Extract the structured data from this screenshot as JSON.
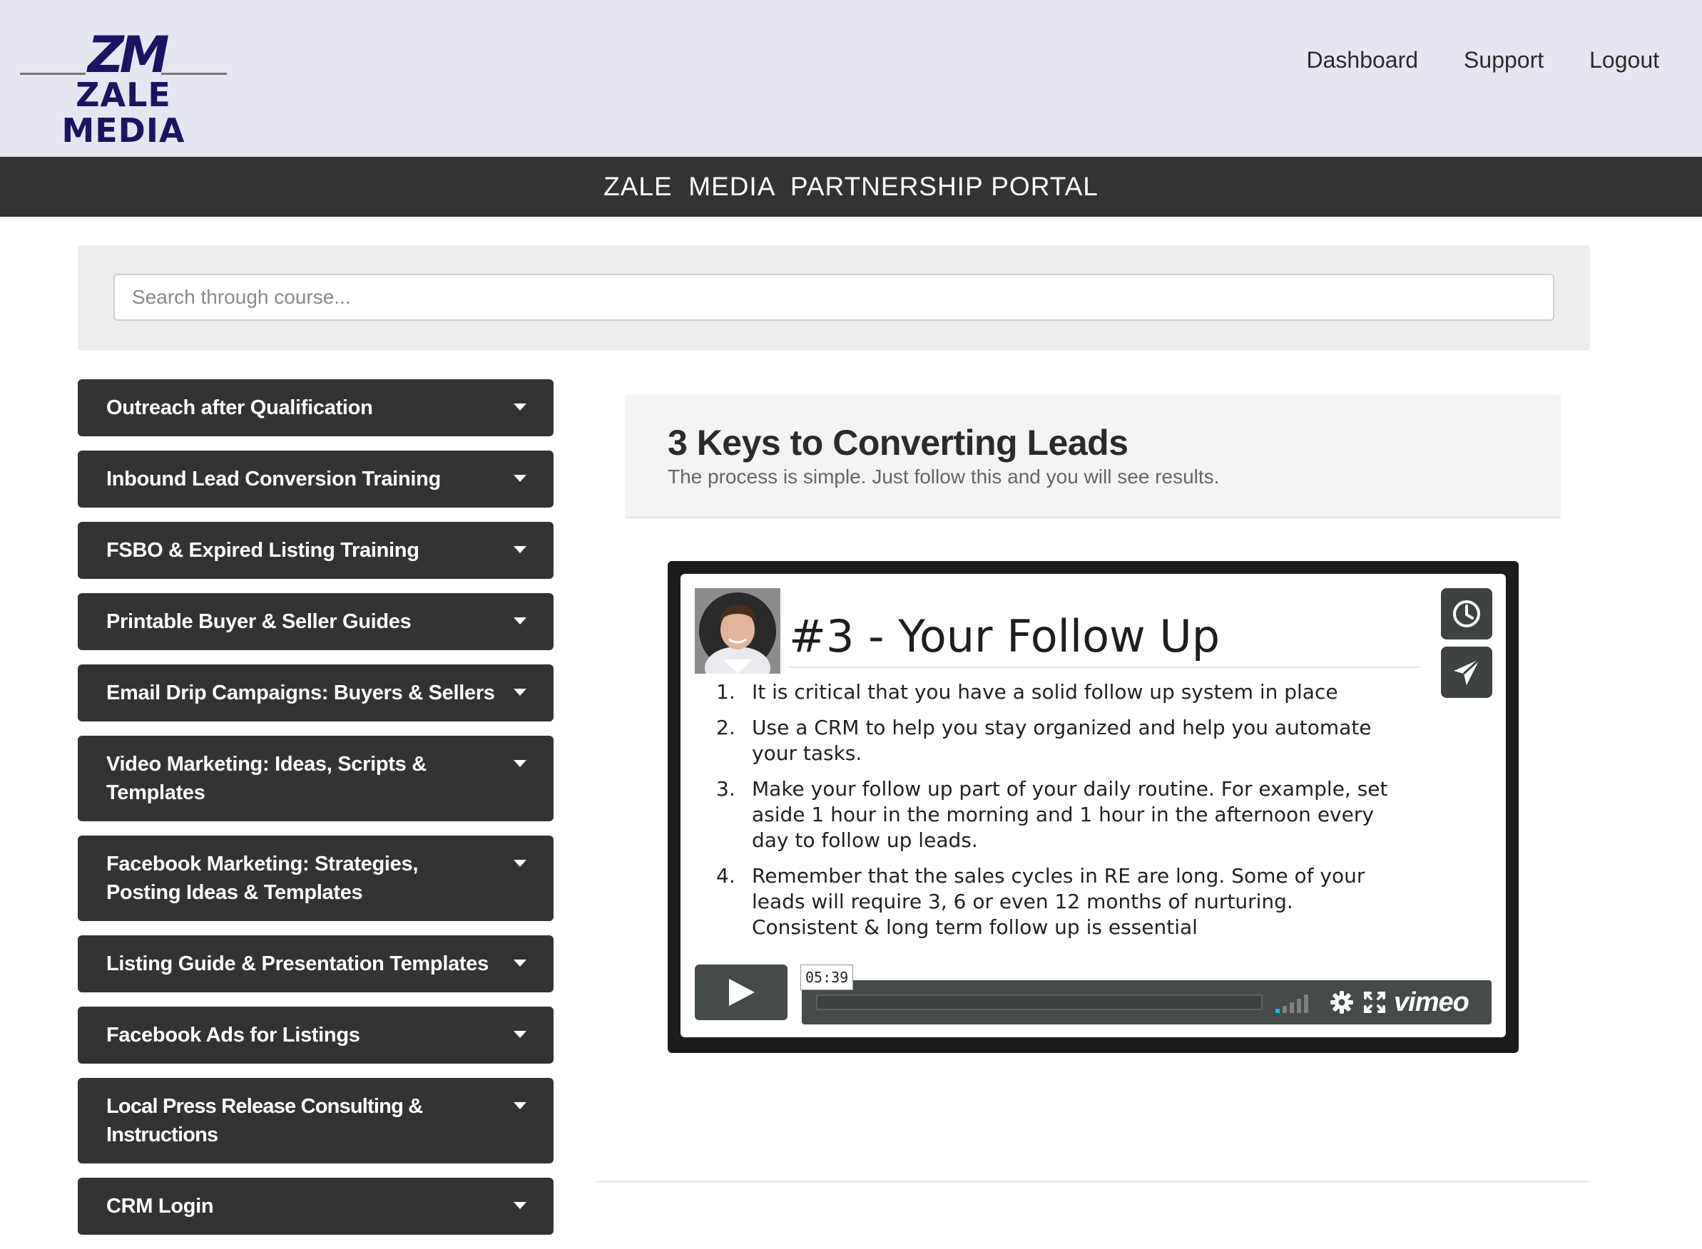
{
  "brand": {
    "monogram": "ZM",
    "name": "ZALE MEDIA",
    "color": "#1a1464"
  },
  "nav": {
    "items": [
      {
        "label": "Dashboard"
      },
      {
        "label": "Support"
      },
      {
        "label": "Logout"
      }
    ]
  },
  "banner": {
    "title": "ZALE  MEDIA  PARTNERSHIP PORTAL"
  },
  "search": {
    "placeholder": "Search through course..."
  },
  "sidebar": {
    "items": [
      {
        "label": "Outreach after Qualification"
      },
      {
        "label": "Inbound Lead Conversion Training"
      },
      {
        "label": "FSBO & Expired Listing Training"
      },
      {
        "label": "Printable Buyer & Seller Guides"
      },
      {
        "label": "Email Drip Campaigns: Buyers & Sellers"
      },
      {
        "label": "Video Marketing: Ideas, Scripts & Templates"
      },
      {
        "label": "Facebook Marketing: Strategies, Posting Ideas & Templates"
      },
      {
        "label": "Listing Guide & Presentation Templates"
      },
      {
        "label": "Facebook Ads for Listings"
      },
      {
        "label": "Local Press Release Consulting & Instructions"
      },
      {
        "label": "CRM Login"
      }
    ]
  },
  "lesson": {
    "title": "3 Keys to Converting Leads",
    "subtitle": "The process is simple. Just follow this and you will see results."
  },
  "video": {
    "title": "#3 - Your Follow Up",
    "steps": [
      {
        "num": "1.",
        "text": "It is critical that you have a solid follow up system in place"
      },
      {
        "num": "2.",
        "text": "Use a CRM to help you stay organized and help you automate your tasks."
      },
      {
        "num": "3.",
        "text": "Make your follow up part of your daily routine. For example, set aside 1 hour in the morning and 1 hour in the afternoon every day to follow up leads."
      },
      {
        "num": "4.",
        "text": "Remember that the sales cycles in RE are long. Some of your leads will require 3, 6 or even 12 months of nurturing. Consistent & long term follow up is essential"
      }
    ],
    "duration": "05:39",
    "provider": "vimeo",
    "icons": {
      "watch_later": "clock-icon",
      "share": "paper-plane-icon",
      "play": "play-icon",
      "volume": "volume-bars-icon",
      "settings": "gear-icon",
      "fullscreen": "fullscreen-icon"
    }
  },
  "colors": {
    "header_bg": "#e6e6f2",
    "banner_bg": "#333333",
    "sidebar_item_bg": "#333333",
    "player_control_bg": "#454a4a"
  }
}
